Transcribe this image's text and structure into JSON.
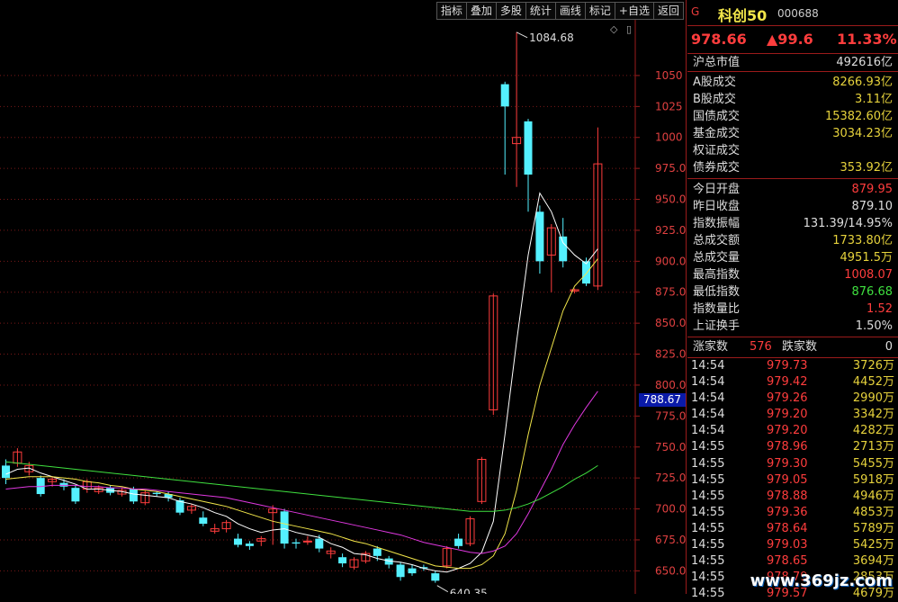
{
  "toolbar": {
    "buttons": [
      "指标",
      "叠加",
      "多股",
      "统计",
      "画线",
      "标记",
      "+自选",
      "返回"
    ]
  },
  "chart_data": {
    "type": "candlestick",
    "y_ticks": [
      "1050",
      "1025",
      "1000",
      "975.0",
      "950.0",
      "925.0",
      "900.0",
      "875.0",
      "850.0",
      "825.0",
      "800.0",
      "775.0",
      "750.0",
      "725.0",
      "700.0",
      "675.0",
      "650.0"
    ],
    "ylim": [
      635,
      1095
    ],
    "high_label": "1084.68",
    "low_label": "640.35",
    "current_price_label": "788.67",
    "candles": [
      {
        "o": 735,
        "c": 725,
        "h": 740,
        "l": 720
      },
      {
        "o": 737,
        "c": 746,
        "h": 749,
        "l": 734
      },
      {
        "o": 730,
        "c": 735,
        "h": 738,
        "l": 727
      },
      {
        "o": 725,
        "c": 712,
        "h": 727,
        "l": 710
      },
      {
        "o": 722,
        "c": 724,
        "h": 726,
        "l": 718
      },
      {
        "o": 721,
        "c": 718,
        "h": 724,
        "l": 715
      },
      {
        "o": 717,
        "c": 706,
        "h": 719,
        "l": 704
      },
      {
        "o": 716,
        "c": 722,
        "h": 724,
        "l": 713
      },
      {
        "o": 714,
        "c": 717,
        "h": 719,
        "l": 712
      },
      {
        "o": 717,
        "c": 713,
        "h": 719,
        "l": 711
      },
      {
        "o": 712,
        "c": 715,
        "h": 717,
        "l": 710
      },
      {
        "o": 716,
        "c": 706,
        "h": 718,
        "l": 704
      },
      {
        "o": 705,
        "c": 713,
        "h": 715,
        "l": 703
      },
      {
        "o": 713,
        "c": 712,
        "h": 714,
        "l": 710
      },
      {
        "o": 712,
        "c": 709,
        "h": 714,
        "l": 706
      },
      {
        "o": 707,
        "c": 697,
        "h": 709,
        "l": 695
      },
      {
        "o": 699,
        "c": 702,
        "h": 704,
        "l": 696
      },
      {
        "o": 693,
        "c": 688,
        "h": 698,
        "l": 686
      },
      {
        "o": 682,
        "c": 684,
        "h": 688,
        "l": 680
      },
      {
        "o": 684,
        "c": 689,
        "h": 691,
        "l": 681
      },
      {
        "o": 676,
        "c": 671,
        "h": 680,
        "l": 669
      },
      {
        "o": 672,
        "c": 670,
        "h": 674,
        "l": 667
      },
      {
        "o": 674,
        "c": 676,
        "h": 678,
        "l": 670
      },
      {
        "o": 697,
        "c": 700,
        "h": 703,
        "l": 671
      },
      {
        "o": 698,
        "c": 672,
        "h": 700,
        "l": 668
      },
      {
        "o": 673,
        "c": 672,
        "h": 676,
        "l": 668
      },
      {
        "o": 674,
        "c": 674,
        "h": 678,
        "l": 671
      },
      {
        "o": 676,
        "c": 668,
        "h": 679,
        "l": 665
      },
      {
        "o": 664,
        "c": 666,
        "h": 669,
        "l": 660
      },
      {
        "o": 661,
        "c": 656,
        "h": 664,
        "l": 653
      },
      {
        "o": 653,
        "c": 659,
        "h": 661,
        "l": 651
      },
      {
        "o": 658,
        "c": 664,
        "h": 666,
        "l": 656
      },
      {
        "o": 668,
        "c": 662,
        "h": 670,
        "l": 658
      },
      {
        "o": 660,
        "c": 655,
        "h": 662,
        "l": 652
      },
      {
        "o": 655,
        "c": 645,
        "h": 657,
        "l": 642
      },
      {
        "o": 652,
        "c": 648,
        "h": 655,
        "l": 646
      },
      {
        "o": 653,
        "c": 652,
        "h": 655,
        "l": 650
      },
      {
        "o": 648,
        "c": 642,
        "h": 650,
        "l": 640.35
      },
      {
        "o": 654,
        "c": 668,
        "h": 670,
        "l": 652
      },
      {
        "o": 676,
        "c": 670,
        "h": 680,
        "l": 668
      },
      {
        "o": 672,
        "c": 692,
        "h": 694,
        "l": 670
      },
      {
        "o": 706,
        "c": 740,
        "h": 742,
        "l": 704
      },
      {
        "o": 780,
        "c": 872,
        "h": 874,
        "l": 776
      },
      {
        "o": 1043,
        "c": 1025,
        "h": 1045,
        "l": 970
      },
      {
        "o": 995,
        "c": 1000,
        "h": 1085,
        "l": 960
      },
      {
        "o": 1013,
        "c": 970,
        "h": 1015,
        "l": 940
      },
      {
        "o": 940,
        "c": 900,
        "h": 945,
        "l": 890
      },
      {
        "o": 905,
        "c": 927,
        "h": 930,
        "l": 875
      },
      {
        "o": 920,
        "c": 900,
        "h": 935,
        "l": 895
      },
      {
        "o": 876,
        "c": 877,
        "h": 878,
        "l": 874
      },
      {
        "o": 900,
        "c": 882,
        "h": 903,
        "l": 880
      },
      {
        "o": 880,
        "c": 978.66,
        "h": 1008.07,
        "l": 876.68
      }
    ],
    "ma_lines": [
      {
        "name": "MA5",
        "color": "#ffffff",
        "values": [
          728,
          732,
          733,
          729,
          726,
          723,
          720,
          716,
          716,
          715,
          714,
          712,
          711,
          710,
          709,
          706,
          704,
          701,
          697,
          694,
          688,
          684,
          681,
          683,
          684,
          681,
          679,
          677,
          672,
          669,
          664,
          663,
          660,
          658,
          657,
          655,
          652,
          650,
          649,
          652,
          656,
          665,
          690,
          760,
          835,
          905,
          955,
          940,
          915,
          905,
          898,
          910
        ]
      },
      {
        "name": "MA10",
        "color": "#f2e64a",
        "values": [
          724,
          725,
          726,
          726,
          726,
          725,
          724,
          722,
          721,
          719,
          718,
          716,
          715,
          714,
          712,
          710,
          708,
          706,
          704,
          702,
          699,
          696,
          693,
          690,
          688,
          686,
          684,
          682,
          680,
          677,
          674,
          672,
          669,
          666,
          663,
          660,
          657,
          654,
          653,
          652,
          652,
          655,
          662,
          680,
          715,
          760,
          800,
          830,
          860,
          880,
          890,
          902
        ]
      },
      {
        "name": "MA20",
        "color": "#e038e0",
        "values": [
          716,
          717,
          718,
          718,
          719,
          719,
          719,
          718,
          718,
          717,
          717,
          716,
          716,
          715,
          714,
          713,
          712,
          711,
          710,
          709,
          707,
          705,
          703,
          701,
          699,
          697,
          695,
          693,
          691,
          689,
          687,
          685,
          683,
          681,
          679,
          676,
          673,
          671,
          669,
          667,
          665,
          664,
          666,
          670,
          680,
          696,
          714,
          732,
          752,
          768,
          782,
          795
        ]
      },
      {
        "name": "MA60",
        "color": "#3fe03f",
        "values": [
          738,
          737,
          736,
          735,
          734,
          733,
          732,
          731,
          730,
          729,
          728,
          727,
          726,
          725,
          724,
          723,
          722,
          721,
          720,
          719,
          718,
          717,
          716,
          715,
          714,
          713,
          712,
          711,
          710,
          709,
          708,
          707,
          706,
          705,
          704,
          703,
          702,
          701,
          700,
          699,
          698,
          698,
          698,
          699,
          701,
          704,
          708,
          713,
          718,
          724,
          729,
          735
        ]
      }
    ]
  },
  "panel": {
    "g_label": "G",
    "name": "科创50",
    "code": "000688",
    "price": "978.66",
    "change": "▲99.6",
    "change_pct": "11.33%",
    "market_cap_label": "沪总市值",
    "market_cap_value": "492616亿",
    "turnover": [
      {
        "k": "A股成交",
        "v": "8266.93亿",
        "c": "yellow"
      },
      {
        "k": "B股成交",
        "v": "3.11亿",
        "c": "yellow"
      },
      {
        "k": "国债成交",
        "v": "15382.60亿",
        "c": "yellow"
      },
      {
        "k": "基金成交",
        "v": "3034.23亿",
        "c": "yellow"
      },
      {
        "k": "权证成交",
        "v": "",
        "c": "yellow"
      },
      {
        "k": "债券成交",
        "v": "353.92亿",
        "c": "yellow"
      }
    ],
    "stats": [
      {
        "k": "今日开盘",
        "v": "879.95",
        "c": "red"
      },
      {
        "k": "昨日收盘",
        "v": "879.10",
        "c": "white"
      },
      {
        "k": "指数振幅",
        "v": "131.39/14.95%",
        "c": "white"
      },
      {
        "k": "总成交额",
        "v": "1733.80亿",
        "c": "yellow"
      },
      {
        "k": "总成交量",
        "v": "4951.5万",
        "c": "yellow"
      },
      {
        "k": "最高指数",
        "v": "1008.07",
        "c": "red"
      },
      {
        "k": "最低指数",
        "v": "876.68",
        "c": "green"
      },
      {
        "k": "指数量比",
        "v": "1.52",
        "c": "red"
      },
      {
        "k": "上证换手",
        "v": "1.50%",
        "c": "white"
      }
    ],
    "up_label": "涨家数",
    "up_value": "576",
    "down_label": "跌家数",
    "down_value": "0",
    "ticks": [
      {
        "t": "14:54",
        "p": "979.73",
        "v": "3726万"
      },
      {
        "t": "14:54",
        "p": "979.42",
        "v": "4452万"
      },
      {
        "t": "14:54",
        "p": "979.26",
        "v": "2990万"
      },
      {
        "t": "14:54",
        "p": "979.20",
        "v": "3342万"
      },
      {
        "t": "14:54",
        "p": "979.20",
        "v": "4282万"
      },
      {
        "t": "14:55",
        "p": "978.96",
        "v": "2713万"
      },
      {
        "t": "14:55",
        "p": "979.30",
        "v": "5455万"
      },
      {
        "t": "14:55",
        "p": "979.05",
        "v": "5918万"
      },
      {
        "t": "14:55",
        "p": "978.88",
        "v": "4946万"
      },
      {
        "t": "14:55",
        "p": "979.36",
        "v": "4853万"
      },
      {
        "t": "14:55",
        "p": "978.64",
        "v": "5789万"
      },
      {
        "t": "14:55",
        "p": "979.03",
        "v": "5425万"
      },
      {
        "t": "14:55",
        "p": "978.65",
        "v": "3694万"
      },
      {
        "t": "14:55",
        "p": "978.79",
        "v": "2853万"
      },
      {
        "t": "14:55",
        "p": "979.57",
        "v": "4679万"
      }
    ]
  },
  "watermark": "www.369jz.com"
}
